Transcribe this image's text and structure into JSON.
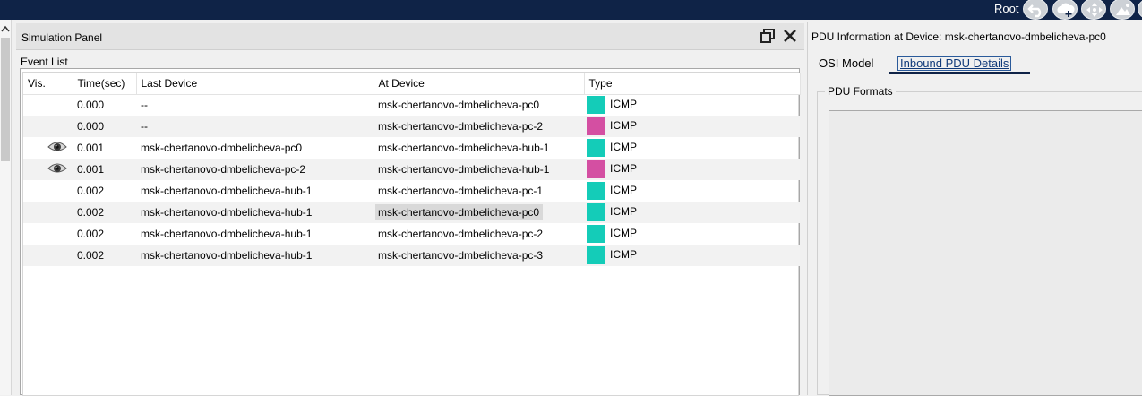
{
  "topbar": {
    "root_label": "Root",
    "icons": [
      "back-arrow-icon",
      "cloud-plus-icon",
      "move-icon",
      "image-icon"
    ]
  },
  "simulation_panel": {
    "title": "Simulation Panel",
    "event_list_label": "Event List",
    "columns": [
      "Vis.",
      "Time(sec)",
      "Last Device",
      "At Device",
      "Type"
    ],
    "rows": [
      {
        "vis": false,
        "time": "0.000",
        "last": "--",
        "at": "msk-chertanovo-dmbelicheva-pc0",
        "color": "#14ccb8",
        "type": "ICMP"
      },
      {
        "vis": false,
        "time": "0.000",
        "last": "--",
        "at": "msk-chertanovo-dmbelicheva-pc-2",
        "color": "#d44fa2",
        "type": "ICMP"
      },
      {
        "vis": true,
        "time": "0.001",
        "last": "msk-chertanovo-dmbelicheva-pc0",
        "at": "msk-chertanovo-dmbelicheva-hub-1",
        "color": "#14ccb8",
        "type": "ICMP"
      },
      {
        "vis": true,
        "time": "0.001",
        "last": "msk-chertanovo-dmbelicheva-pc-2",
        "at": "msk-chertanovo-dmbelicheva-hub-1",
        "color": "#d44fa2",
        "type": "ICMP"
      },
      {
        "vis": false,
        "time": "0.002",
        "last": "msk-chertanovo-dmbelicheva-hub-1",
        "at": "msk-chertanovo-dmbelicheva-pc-1",
        "color": "#14ccb8",
        "type": "ICMP"
      },
      {
        "vis": false,
        "time": "0.002",
        "last": "msk-chertanovo-dmbelicheva-hub-1",
        "at": "msk-chertanovo-dmbelicheva-pc0",
        "color": "#14ccb8",
        "type": "ICMP",
        "selected": true
      },
      {
        "vis": false,
        "time": "0.002",
        "last": "msk-chertanovo-dmbelicheva-hub-1",
        "at": "msk-chertanovo-dmbelicheva-pc-2",
        "color": "#14ccb8",
        "type": "ICMP"
      },
      {
        "vis": false,
        "time": "0.002",
        "last": "msk-chertanovo-dmbelicheva-hub-1",
        "at": "msk-chertanovo-dmbelicheva-pc-3",
        "color": "#14ccb8",
        "type": "ICMP"
      }
    ]
  },
  "pdu_panel": {
    "title": "PDU Information at Device: msk-chertanovo-dmbelicheva-pc0",
    "tabs": [
      "OSI Model",
      "Inbound PDU Details"
    ],
    "active_tab": "Inbound PDU Details",
    "formats_label": "PDU Formats"
  }
}
